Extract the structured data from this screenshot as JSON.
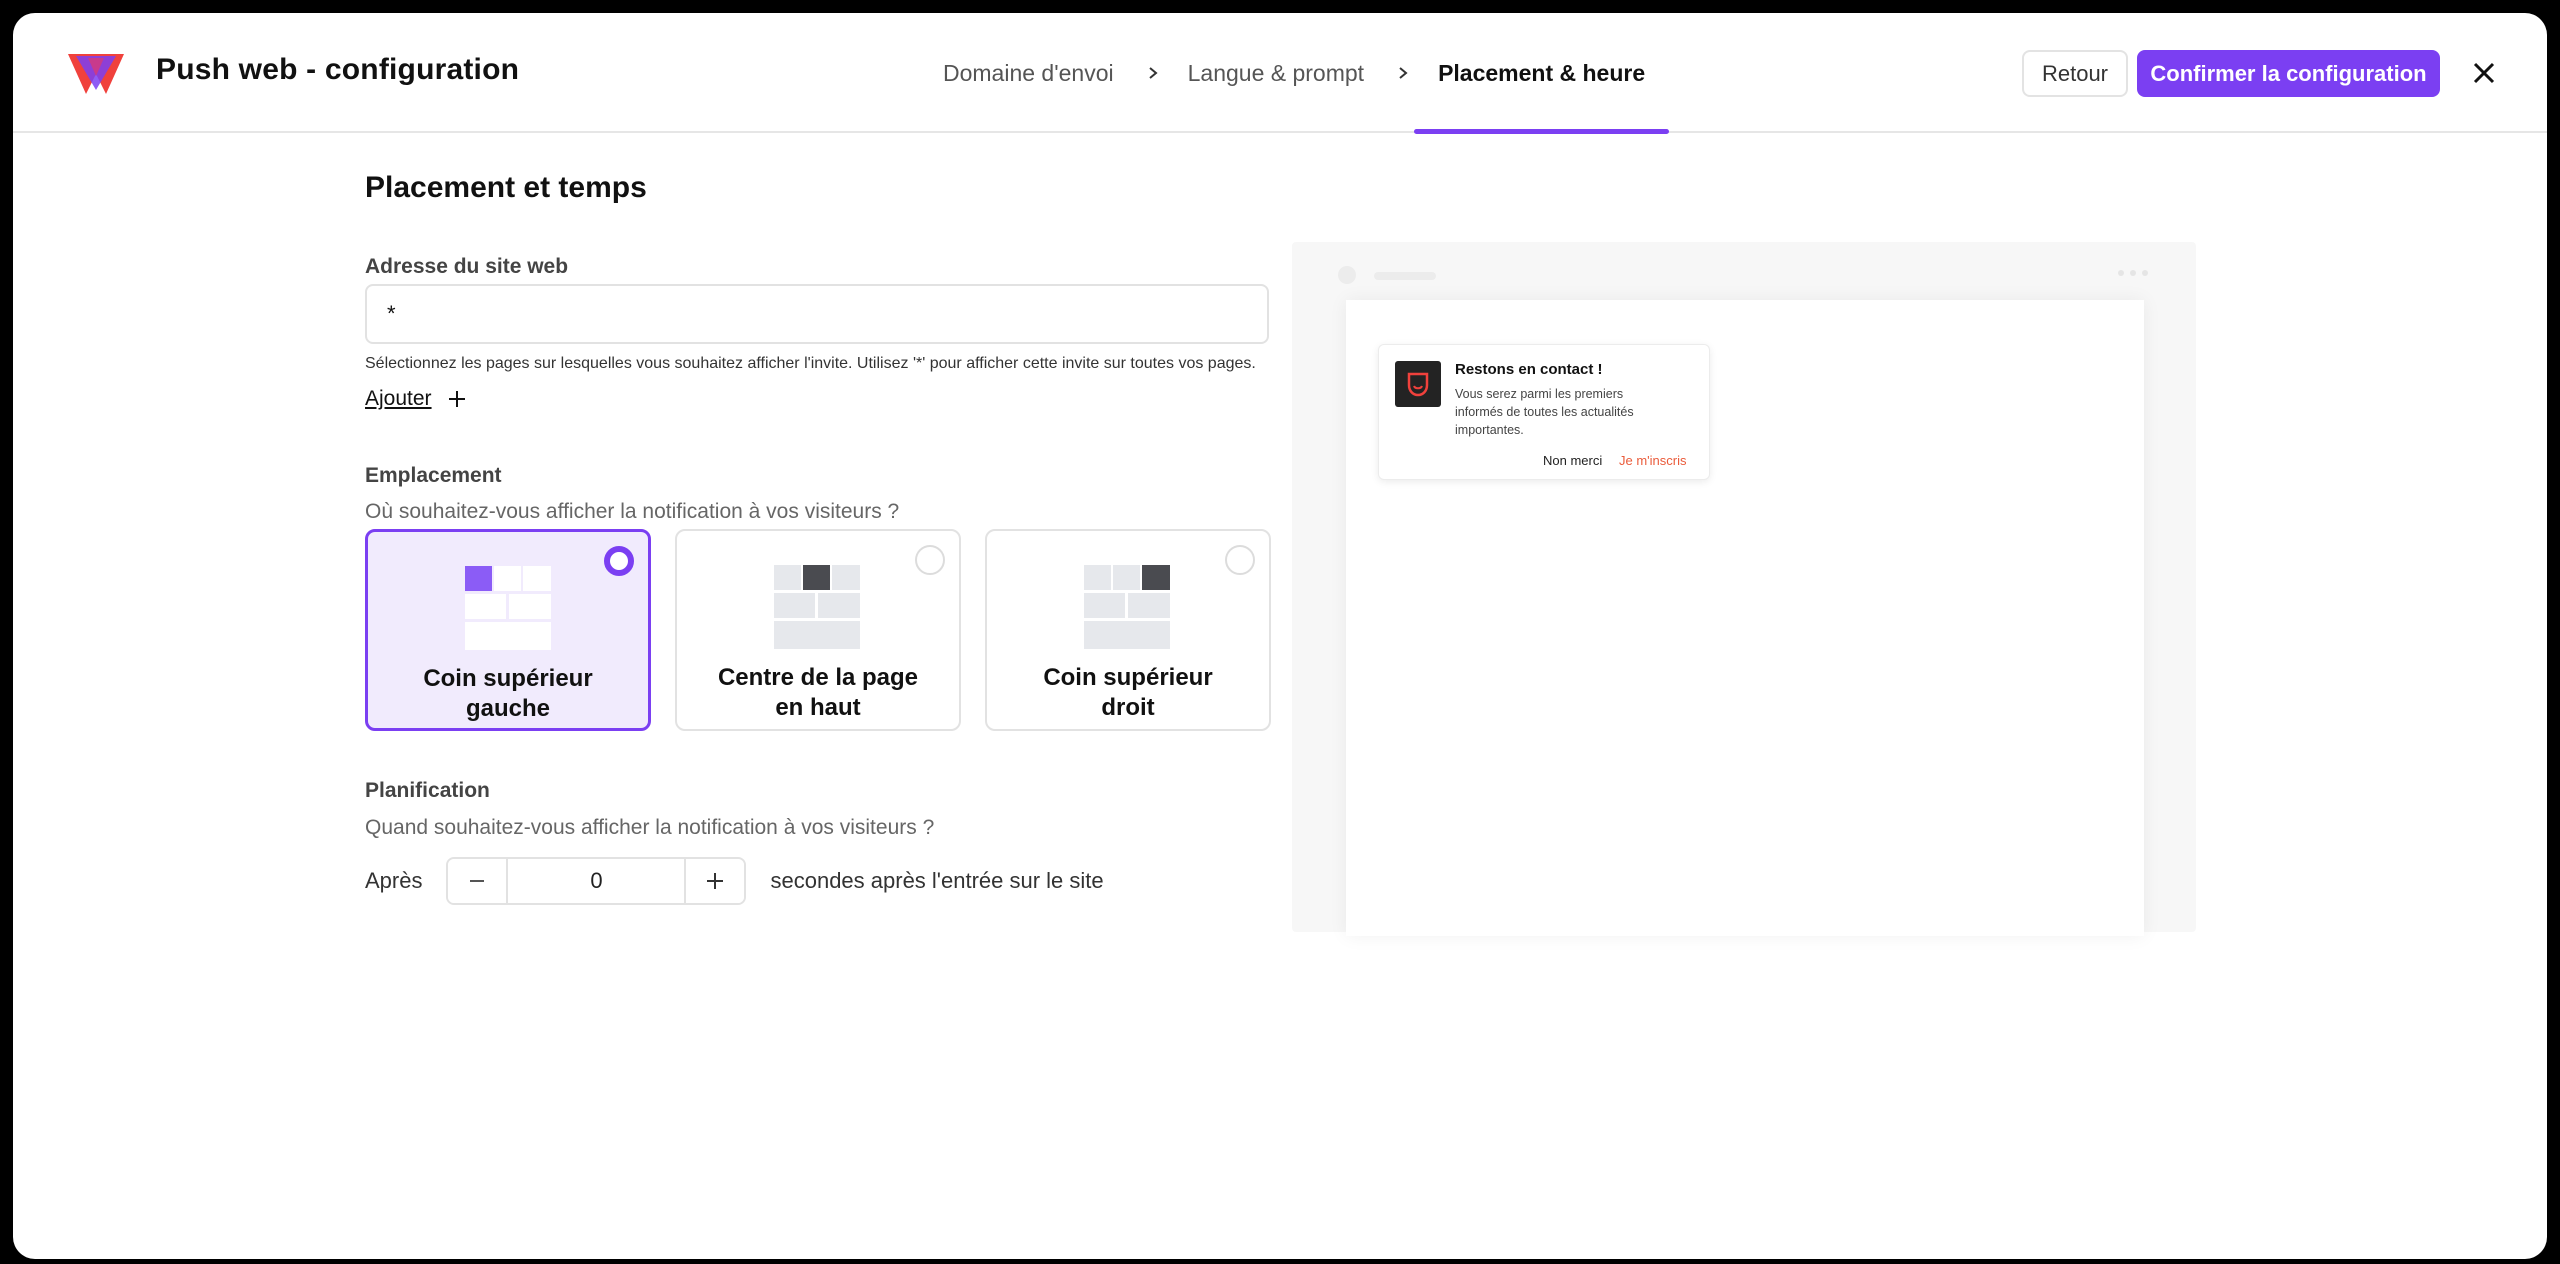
{
  "header": {
    "app_title": "Push web - configuration",
    "steps": [
      {
        "label": "Domaine d'envoi"
      },
      {
        "label": "Langue & prompt"
      },
      {
        "label": "Placement & heure"
      }
    ],
    "back_label": "Retour",
    "confirm_label": "Confirmer la configuration"
  },
  "main": {
    "section_title": "Placement et temps",
    "website": {
      "label": "Adresse du site web",
      "value": "*",
      "helper": "Sélectionnez les pages sur lesquelles vous souhaitez afficher l'invite. Utilisez '*' pour afficher cette invite sur toutes vos pages.",
      "add_label": "Ajouter"
    },
    "placement": {
      "label": "Emplacement",
      "question": "Où souhaitez-vous afficher la notification à vos visiteurs ?",
      "options": [
        {
          "label": "Coin supérieur gauche",
          "selected": true
        },
        {
          "label": "Centre de la page en haut",
          "selected": false
        },
        {
          "label": "Coin supérieur droit",
          "selected": false
        }
      ]
    },
    "schedule": {
      "label": "Planification",
      "question": "Quand souhaitez-vous afficher la notification à vos visiteurs ?",
      "prefix": "Après",
      "value": "0",
      "suffix": "secondes après l'entrée sur le site"
    }
  },
  "preview": {
    "notification": {
      "title": "Restons en contact !",
      "body": "Vous serez parmi les premiers informés de toutes les actualités importantes.",
      "decline_label": "Non merci",
      "accept_label": "Je m'inscris"
    }
  },
  "colors": {
    "accent": "#7b3ff2",
    "accept_link": "#ea5b3a"
  }
}
